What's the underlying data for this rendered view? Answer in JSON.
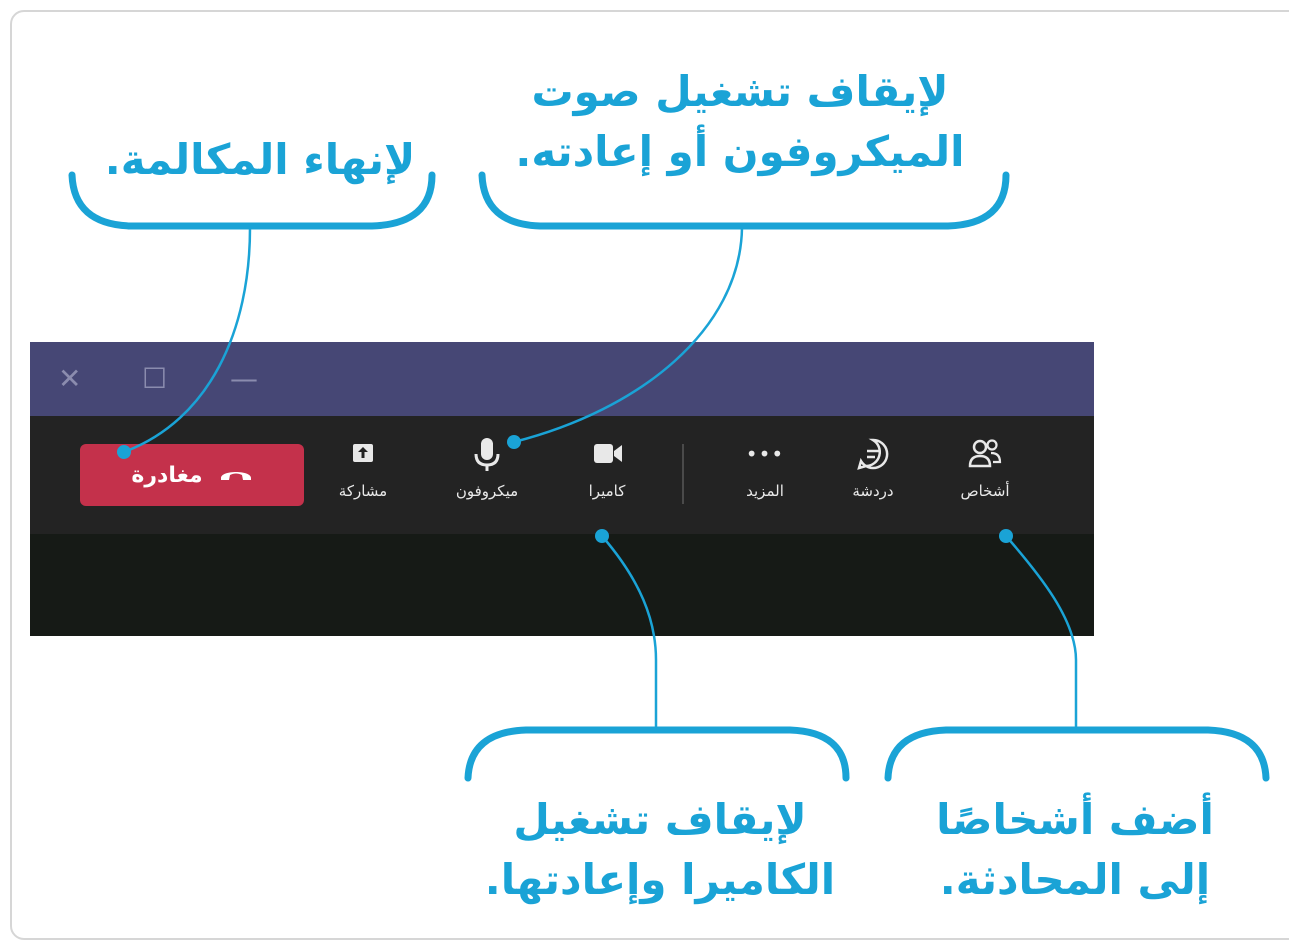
{
  "callouts": {
    "end_call": "لإنهاء المكالمة.",
    "mic_line1": "لإيقاف تشغيل صوت",
    "mic_line2": "الميكروفون أو إعادته.",
    "camera_line1": "لإيقاف تشغيل",
    "camera_line2": "الكاميرا وإعادتها.",
    "people_line1": "أضف أشخاصًا",
    "people_line2": "إلى المحادثة."
  },
  "window_controls": {
    "close": "✕",
    "maximize": "☐",
    "minimize": "—"
  },
  "toolbar": {
    "leave_label": "مغادرة",
    "share_label": "مشاركة",
    "microphone_label": "ميكروفون",
    "camera_label": "كاميرا",
    "more_label": "المزيد",
    "more_glyph": "•••",
    "chat_label": "دردشة",
    "people_label": "أشخاص"
  },
  "icons": {
    "leave": "phone-hangup-icon",
    "share": "share-tray-icon",
    "microphone": "microphone-icon",
    "camera": "video-camera-icon",
    "more": "more-dots-icon",
    "chat": "chat-bubble-icon",
    "people": "people-icon"
  },
  "colors": {
    "callout": "#1aa3d6",
    "titlebar": "#464775",
    "toolbar": "#232323",
    "leave_button": "#c4314b"
  }
}
